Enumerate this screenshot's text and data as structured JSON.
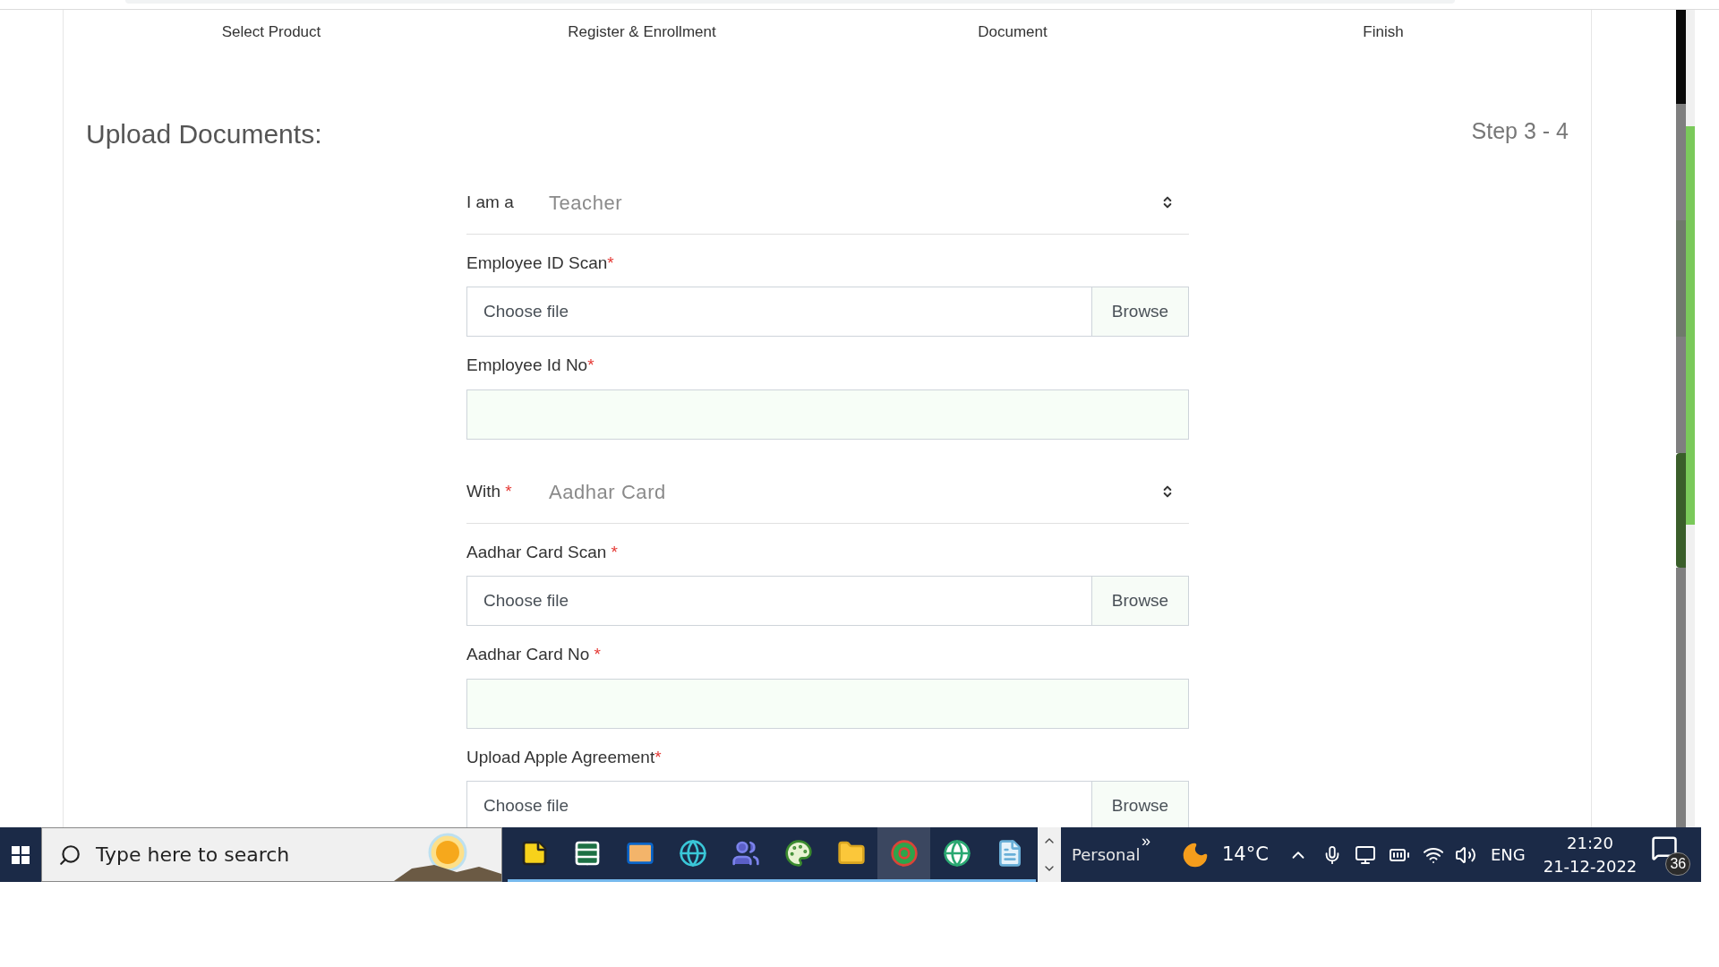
{
  "steps": [
    {
      "label": "Select Product"
    },
    {
      "label": "Register & Enrollment"
    },
    {
      "label": "Document"
    },
    {
      "label": "Finish"
    }
  ],
  "heading": "Upload Documents:",
  "step_indicator": "Step 3 - 4",
  "fields": [
    {
      "kind": "select",
      "label": "I am a",
      "value": "Teacher"
    },
    {
      "kind": "file",
      "label": "Employee ID Scan",
      "mark": "*",
      "placeholder": "Choose file",
      "button": "Browse"
    },
    {
      "kind": "text",
      "label": "Employee Id No",
      "mark": "*"
    },
    {
      "kind": "select",
      "label": "With",
      "mark": " *",
      "value": "Aadhar Card"
    },
    {
      "kind": "file",
      "label": "Aadhar Card Scan",
      "mark": " *",
      "placeholder": "Choose file",
      "button": "Browse"
    },
    {
      "kind": "text",
      "label": "Aadhar Card No",
      "mark": " *"
    },
    {
      "kind": "file",
      "label": "Upload Apple Agreement",
      "mark": "*",
      "placeholder": "Choose file",
      "button": "Browse"
    }
  ],
  "taskbar": {
    "search_placeholder": "Type here to search",
    "apps": [
      {
        "kind": "sticky",
        "selected": false
      },
      {
        "kind": "sheet",
        "selected": false
      },
      {
        "kind": "mail",
        "selected": false
      },
      {
        "kind": "edge",
        "selected": false
      },
      {
        "kind": "teams",
        "selected": false
      },
      {
        "kind": "paint",
        "selected": false
      },
      {
        "kind": "folder",
        "selected": false
      },
      {
        "kind": "chrome",
        "selected": true
      },
      {
        "kind": "globe",
        "selected": false
      },
      {
        "kind": "notepad",
        "selected": false
      }
    ],
    "profile": "Personal",
    "chevrons": "»",
    "temperature": "14°C",
    "language": "ENG",
    "time": "21:20",
    "date": "21-12-2022",
    "notifications": "36"
  }
}
